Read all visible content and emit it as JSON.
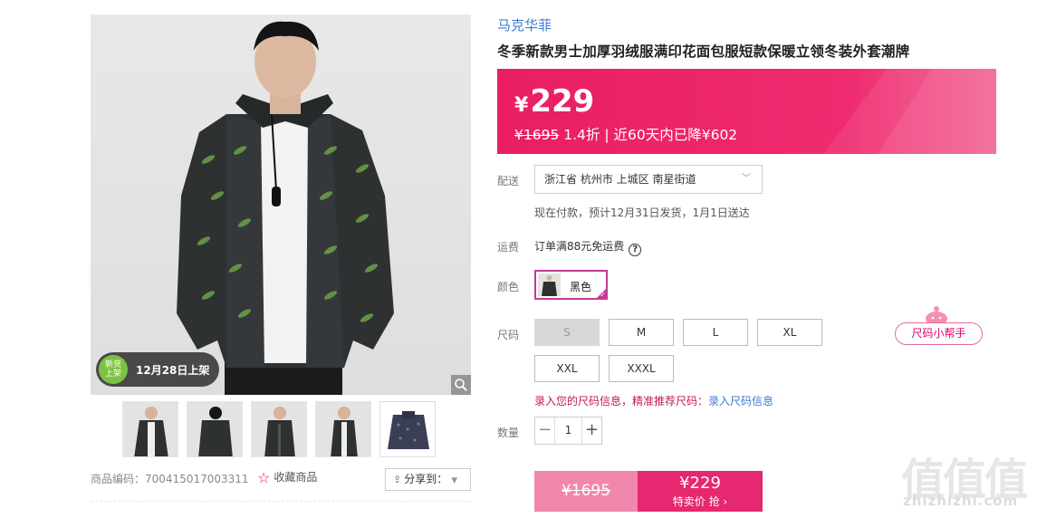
{
  "gallery": {
    "new_badge_line1": "新货",
    "new_badge_line2": "上架",
    "launch_date": "12月28日上架",
    "thumbnails": [
      "front-open",
      "back",
      "front-zip",
      "side",
      "flat-navy"
    ]
  },
  "product": {
    "brand": "马克华菲",
    "title": "冬季新款男士加厚羽绒服满印花面包服短款保暖立领冬装外套潮牌",
    "currency": "¥",
    "price": "229",
    "original_price": "¥1695",
    "discount": "1.4折",
    "price_drop_note": "| 近60天内已降¥602",
    "sku_code_label": "商品编码：",
    "sku_code": "700415017003311",
    "favorite_label": "收藏商品",
    "share_label": "分享到："
  },
  "delivery": {
    "label": "配送",
    "address": "浙江省 杭州市 上城区 南星街道",
    "note": "现在付款，预计12月31日发货，1月1日送达"
  },
  "freight": {
    "label": "运费",
    "text": "订单满88元免运费",
    "help": "?"
  },
  "color": {
    "label": "颜色",
    "selected": "黑色"
  },
  "size": {
    "label": "尺码",
    "options": [
      "S",
      "M",
      "L",
      "XL",
      "XXL",
      "XXXL"
    ],
    "disabled": [
      "S"
    ],
    "helper_label": "尺码小帮手",
    "tip_text": "录入您的尺码信息，精准推荐尺码：",
    "tip_link": "录入尺码信息"
  },
  "quantity": {
    "label": "数量",
    "value": "1",
    "minus": "−",
    "plus": "+"
  },
  "buy": {
    "original_price": "¥1695",
    "sale_price": "¥229",
    "sale_label": "特卖价 抢 ›"
  },
  "watermark": {
    "glyphs": "值值值",
    "domain": "zhizhizhi.com"
  },
  "colors": {
    "accent": "#e91e63",
    "brand_link": "#3c7bd0",
    "selected_border": "#c23a91"
  }
}
